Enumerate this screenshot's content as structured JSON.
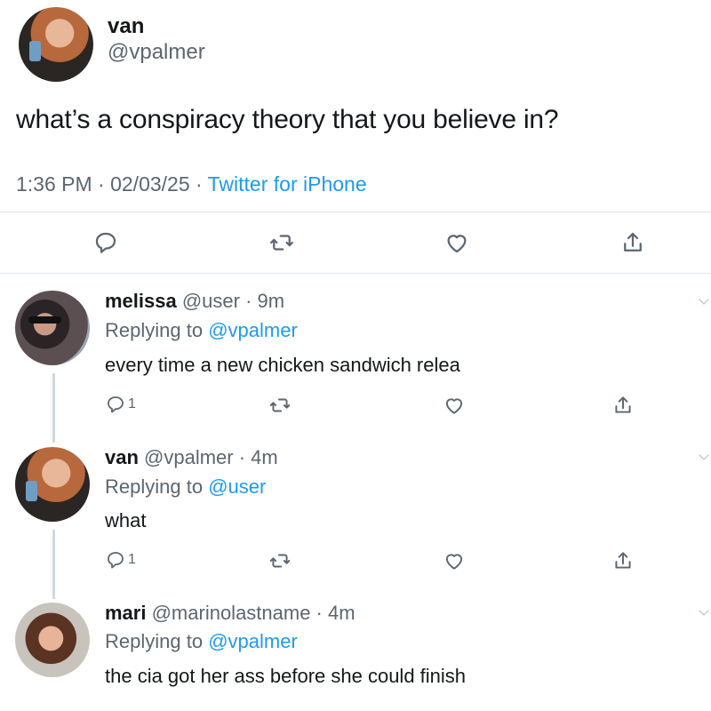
{
  "main_tweet": {
    "display_name": "van",
    "handle": "@vpalmer",
    "text": "what’s a conspiracy theory that you believe in?",
    "time": "1:36 PM · 02/03/25 · ",
    "source": "Twitter for iPhone"
  },
  "replies": [
    {
      "display_name": "melissa",
      "handle_time": " @user · 9m",
      "replying_prefix": "Replying to ",
      "replying_to": "@vpalmer",
      "text": "every time a new chicken sandwich relea",
      "reply_count": "1"
    },
    {
      "display_name": "van",
      "handle_time": " @vpalmer · 4m",
      "replying_prefix": "Replying to ",
      "replying_to": "@user",
      "text": "what",
      "reply_count": "1"
    },
    {
      "display_name": "mari",
      "handle_time": " @marinolastname · 4m",
      "replying_prefix": "Replying to ",
      "replying_to": "@vpalmer",
      "text": "the cia got her ass before she could finish"
    }
  ],
  "colors": {
    "link": "#1d9bf0",
    "secondary_text": "#5b6670",
    "divider": "#e1e8ed"
  },
  "icons": [
    "reply-icon",
    "retweet-icon",
    "like-icon",
    "share-icon",
    "chevron-down-icon"
  ]
}
